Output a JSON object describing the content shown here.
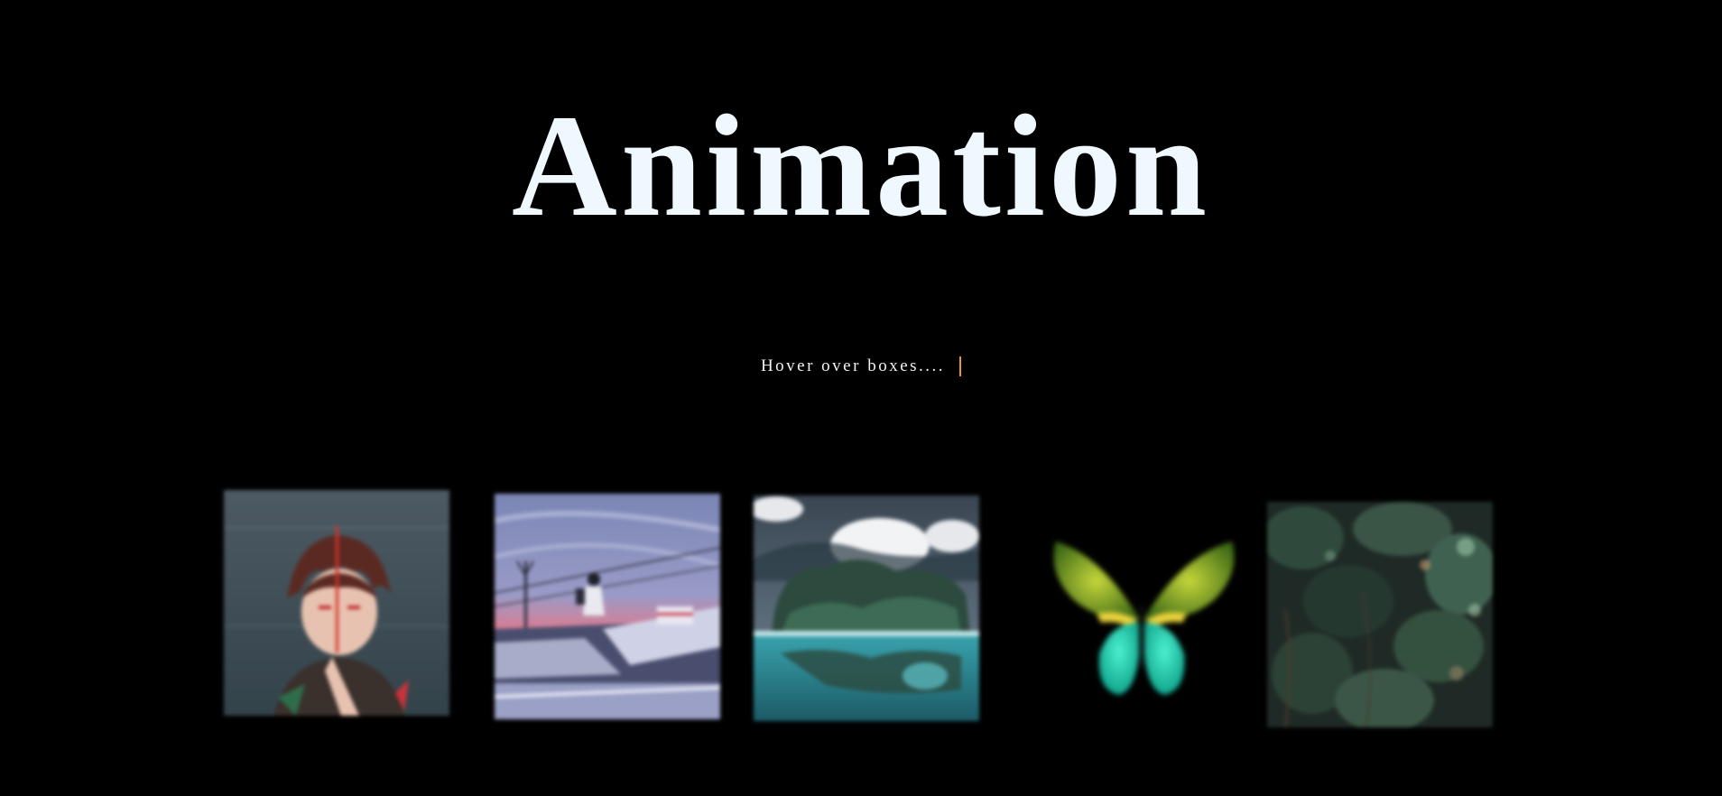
{
  "header": {
    "title": "Animation",
    "subtitle": "Hover over boxes...."
  },
  "colors": {
    "background": "#000000",
    "title": "#f0f8ff",
    "caret": "#e39a3e"
  },
  "gallery": {
    "items": [
      {
        "name": "anime-portrait-image"
      },
      {
        "name": "rooftop-sunset-image"
      },
      {
        "name": "island-lake-image"
      },
      {
        "name": "butterfly-image"
      },
      {
        "name": "forest-foliage-image"
      }
    ]
  }
}
